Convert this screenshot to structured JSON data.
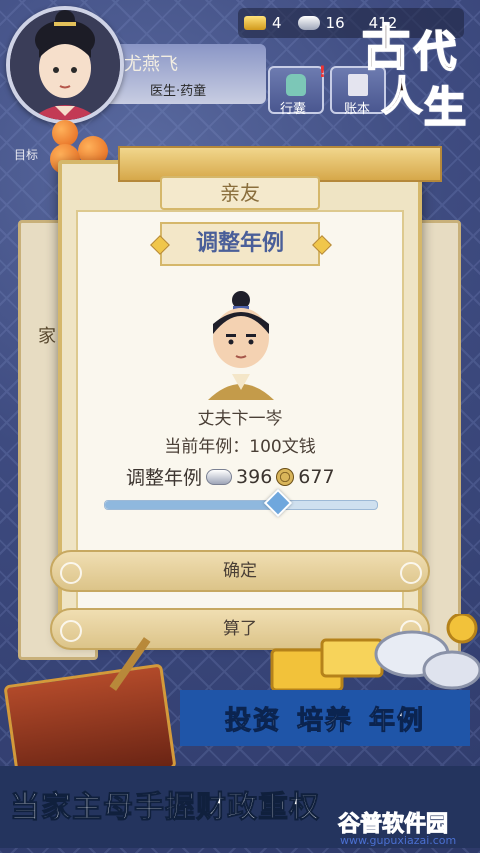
{
  "player": {
    "name": "尤燕飞",
    "title": "医生·药童"
  },
  "resources": {
    "gold": "4",
    "silver": "16",
    "third": "412"
  },
  "top_buttons": {
    "bag": "行囊",
    "ledger": "账本"
  },
  "mission_label": "目标",
  "logo": {
    "chars": [
      "古",
      "代",
      "人",
      "生"
    ]
  },
  "side_panels": {
    "left_fragment": "家"
  },
  "dialog": {
    "tab_label": "亲友",
    "title": "调整年例",
    "character_name": "丈夫卞一岑",
    "current_rate": "当前年例：100文钱",
    "adjust_label": "调整年例",
    "silver_amount": "396",
    "coin_amount": "677",
    "slider_value": 0.64,
    "confirm_label": "确定",
    "cancel_label": "算了"
  },
  "promo": {
    "tags": [
      "投资",
      "培养",
      "年例"
    ],
    "slogan": "当家主母手握财政重权"
  },
  "watermark": {
    "name": "谷普软件园",
    "url": "www.gupuxiazai.com"
  },
  "colors": {
    "accent_blue": "#4a5f99",
    "gold": "#d5b76a",
    "promo_blue": "#1f55a8"
  }
}
